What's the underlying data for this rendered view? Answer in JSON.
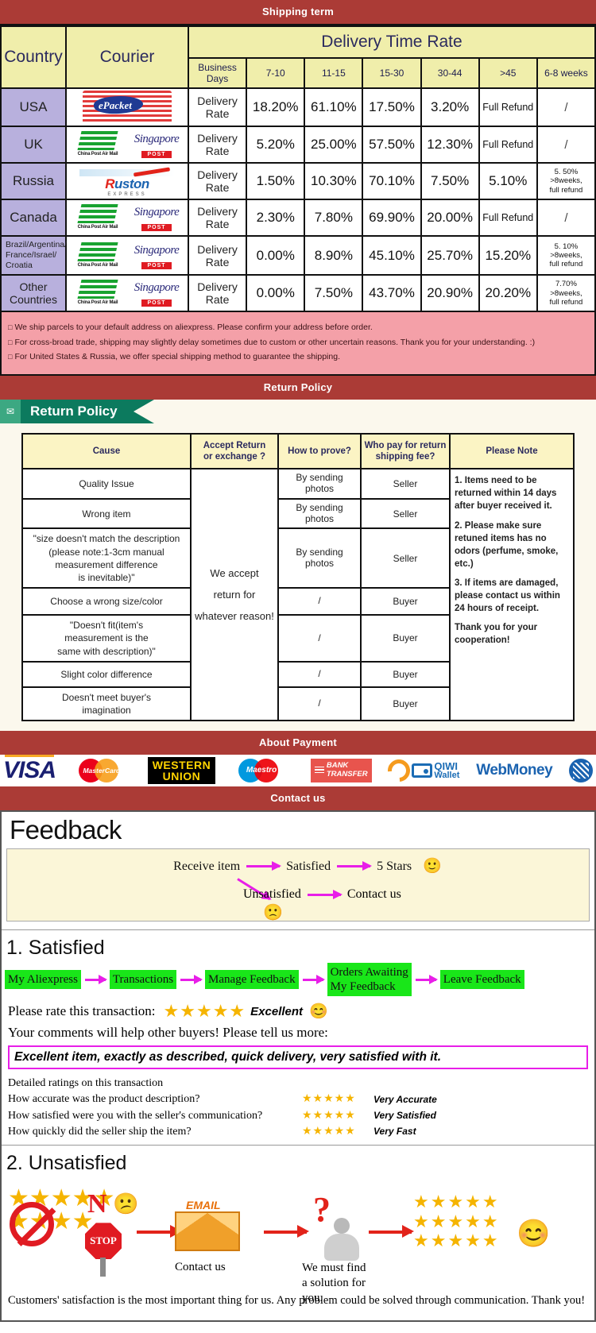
{
  "banners": {
    "shipping": "Shipping term",
    "return": "Return Policy",
    "payment": "About Payment",
    "contact": "Contact us"
  },
  "shipping_table": {
    "headers": {
      "country": "Country",
      "courier": "Courier",
      "delivery_time_rate": "Delivery Time Rate",
      "business_days": "Business Days",
      "cols": [
        "7-10",
        "11-15",
        "15-30",
        "30-44",
        ">45",
        "6-8 weeks"
      ]
    },
    "rate_label": "Delivery Rate",
    "rows": [
      {
        "country": "USA",
        "couriers": [
          "epacket"
        ],
        "values": [
          "18.20%",
          "61.10%",
          "17.50%",
          "3.20%",
          "Full Refund",
          "/"
        ]
      },
      {
        "country": "UK",
        "couriers": [
          "china-post-air-mail",
          "singapore-post"
        ],
        "values": [
          "5.20%",
          "25.00%",
          "57.50%",
          "12.30%",
          "Full Refund",
          "/"
        ]
      },
      {
        "country": "Russia",
        "couriers": [
          "ruston-express"
        ],
        "values": [
          "1.50%",
          "10.30%",
          "70.10%",
          "7.50%",
          "5.10%",
          "5. 50%\n>8weeks,\nfull refund"
        ]
      },
      {
        "country": "Canada",
        "couriers": [
          "china-post-air-mail",
          "singapore-post"
        ],
        "values": [
          "2.30%",
          "7.80%",
          "69.90%",
          "20.00%",
          "Full Refund",
          "/"
        ]
      },
      {
        "country": "Brazil/Argentina/\nFrance/Israel/\nCroatia",
        "couriers": [
          "china-post-air-mail",
          "singapore-post"
        ],
        "values": [
          "0.00%",
          "8.90%",
          "45.10%",
          "25.70%",
          "15.20%",
          "5. 10%\n>8weeks,\nfull refund"
        ]
      },
      {
        "country": "Other Countries",
        "couriers": [
          "china-post-air-mail",
          "singapore-post"
        ],
        "values": [
          "0.00%",
          "7.50%",
          "43.70%",
          "20.90%",
          "20.20%",
          "7.70%\n>8weeks,\nfull refund"
        ]
      }
    ],
    "logo_text": {
      "epacket": "ePacket",
      "china_post": "China Post Air Mail",
      "singapore_word": "Singapore",
      "singapore_post": "POST",
      "ruston": "uston",
      "ruston_initial": "R",
      "ruston_sub": "EXPRESS"
    },
    "notes": [
      "We ship parcels to your default address on aliexpress. Please confirm your address before order.",
      "For cross-broad trade, shipping may slightly delay sometimes due to custom or other uncertain reasons. Thank you for your understanding. :)",
      "For United States & Russia, we offer special shipping method to guarantee the shipping."
    ]
  },
  "return_policy": {
    "ribbon_title": "Return Policy",
    "headers": [
      "Cause",
      "Accept Return\nor exchange ?",
      "How to prove?",
      "Who pay for return\nshipping fee?",
      "Please Note"
    ],
    "accept_cell": "We accept\nreturn for\nwhatever reason!",
    "rows": [
      {
        "cause": "Quality Issue",
        "prove": "By sending\nphotos",
        "who": "Seller"
      },
      {
        "cause": "Wrong item",
        "prove": "By sending\nphotos",
        "who": "Seller"
      },
      {
        "cause": "\"size doesn't match the description\n(please note:1-3cm manual\nmeasurement difference\nis inevitable)\"",
        "prove": "By sending\nphotos",
        "who": "Seller"
      },
      {
        "cause": "Choose a wrong size/color",
        "prove": "/",
        "who": "Buyer"
      },
      {
        "cause": "\"Doesn't fit(item's\nmeasurement is the\nsame with description)\"",
        "prove": "/",
        "who": "Buyer"
      },
      {
        "cause": "Slight color difference",
        "prove": "/",
        "who": "Buyer"
      },
      {
        "cause": "Doesn't meet buyer's\nimagination",
        "prove": "/",
        "who": "Buyer"
      }
    ],
    "notes": [
      "1. Items need to be returned within 14 days after buyer received it.",
      "2. Please make sure retuned items has no odors (perfume, smoke, etc.)",
      "3. If items are damaged, please contact us within 24 hours of receipt.",
      "Thank you for your cooperation!"
    ]
  },
  "payment": {
    "methods": [
      {
        "name": "visa",
        "label": "VISA"
      },
      {
        "name": "mastercard",
        "label": "MasterCard"
      },
      {
        "name": "western-union",
        "label_1": "WESTERN",
        "label_2": "UNION"
      },
      {
        "name": "maestro",
        "label": "Maestro"
      },
      {
        "name": "bank-transfer",
        "label_1": "BANK",
        "label_2": "TRANSFER"
      },
      {
        "name": "qiwi-wallet",
        "label_1": "QIWI",
        "label_2": "Wallet"
      },
      {
        "name": "webmoney",
        "label": "WebMoney"
      }
    ]
  },
  "feedback": {
    "title": "Feedback",
    "flow": {
      "start": "Receive item",
      "satisfied": "Satisfied",
      "five_stars": "5 Stars",
      "unsatisfied": "Unsatisfied",
      "contact": "Contact us",
      "smiley": "🙂",
      "frowny": "🙁"
    },
    "satisfied": {
      "heading": "1. Satisfied",
      "steps": [
        "My Aliexpress",
        "Transactions",
        "Manage Feedback",
        "Orders Awaiting\nMy Feedback",
        "Leave Feedback"
      ],
      "rate_prompt": "Please rate this transaction:",
      "stars": "★★★★★",
      "rating_word": "Excellent",
      "rating_emoji": "😊",
      "comments_prompt": "Your comments will help other buyers! Please tell us more:",
      "comment_text": "Excellent item, exactly as described, quick delivery, very satisfied with it.",
      "detailed_heading": "Detailed ratings on this transaction",
      "detailed": [
        {
          "question": "How accurate was the product description?",
          "stars": "★★★★★",
          "value": "Very Accurate"
        },
        {
          "question": "How satisfied were you with the seller's communication?",
          "stars": "★★★★★",
          "value": "Very Satisfied"
        },
        {
          "question": "How quickly did the seller ship the item?",
          "stars": "★★★★★",
          "value": "Very Fast"
        }
      ]
    },
    "unsatisfied": {
      "heading": "2. Unsatisfied",
      "no_label": "N",
      "stop_label": "STOP",
      "email_label": "EMAIL",
      "contact_caption": "Contact us",
      "question_mark": "?",
      "solution_caption": "We must find\na solution for\nyou.",
      "sad_emoji": "😕",
      "happy_emoji": "😊",
      "stars_block": "★★★★★\n★★★★★\n★★★★★"
    },
    "footnote": "Customers' satisfaction is the most important thing for us. Any problem could be solved through communication. Thank you!"
  }
}
